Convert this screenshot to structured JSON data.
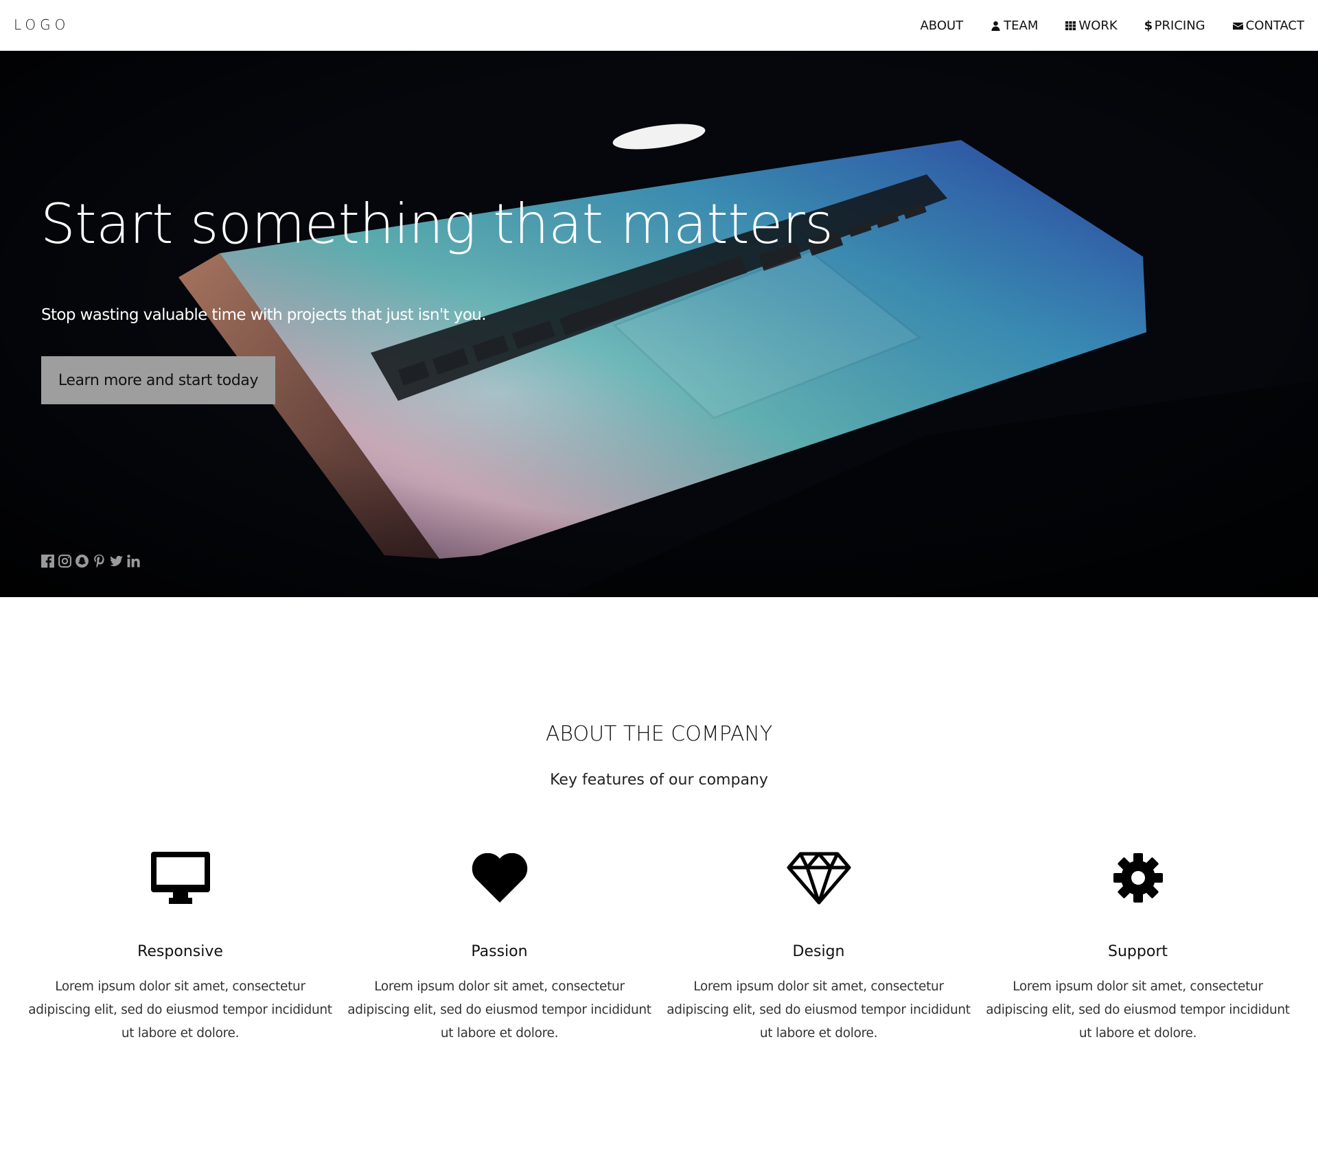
{
  "nav": {
    "logo": "LOGO",
    "items": [
      {
        "label": "ABOUT",
        "icon": ""
      },
      {
        "label": "TEAM",
        "icon": "user-icon"
      },
      {
        "label": "WORK",
        "icon": "grid-icon"
      },
      {
        "label": "PRICING",
        "icon": "dollar-icon"
      },
      {
        "label": "CONTACT",
        "icon": "envelope-icon"
      }
    ]
  },
  "hero": {
    "title": "Start something that matters",
    "subtitle": "Stop wasting valuable time with projects that just isn't you.",
    "button_label": "Learn more and start today",
    "social_icons": [
      "facebook-icon",
      "instagram-icon",
      "snapchat-icon",
      "pinterest-icon",
      "twitter-icon",
      "linkedin-icon"
    ]
  },
  "about": {
    "title": "ABOUT THE COMPANY",
    "subtitle": "Key features of our company",
    "features": [
      {
        "icon": "desktop-icon",
        "title": "Responsive",
        "text": "Lorem ipsum dolor sit amet, consectetur adipiscing elit, sed do eiusmod tempor incididunt ut labore et dolore."
      },
      {
        "icon": "heart-icon",
        "title": "Passion",
        "text": "Lorem ipsum dolor sit amet, consectetur adipiscing elit, sed do eiusmod tempor incididunt ut labore et dolore."
      },
      {
        "icon": "diamond-icon",
        "title": "Design",
        "text": "Lorem ipsum dolor sit amet, consectetur adipiscing elit, sed do eiusmod tempor incididunt ut labore et dolore."
      },
      {
        "icon": "gear-icon",
        "title": "Support",
        "text": "Lorem ipsum dolor sit amet, consectetur adipiscing elit, sed do eiusmod tempor incididunt ut labore et dolore."
      }
    ]
  },
  "colors": {
    "hero_background": "#05070c",
    "button_background": "#9e9e9e",
    "social_icon": "#9a9a9a"
  }
}
